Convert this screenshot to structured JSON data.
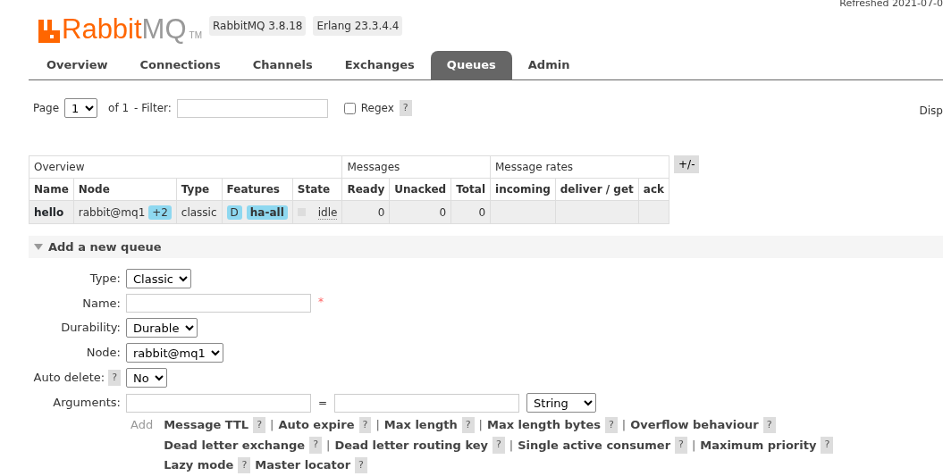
{
  "header": {
    "logo_main": "Rabbit",
    "logo_suffix": "MQ",
    "logo_tm": "TM",
    "versions": [
      "RabbitMQ 3.8.18",
      "Erlang 23.3.4.4"
    ],
    "refreshed": "Refreshed 2021-07-0"
  },
  "tabs": [
    {
      "label": "Overview",
      "selected": false
    },
    {
      "label": "Connections",
      "selected": false
    },
    {
      "label": "Channels",
      "selected": false
    },
    {
      "label": "Exchanges",
      "selected": false
    },
    {
      "label": "Queues",
      "selected": true
    },
    {
      "label": "Admin",
      "selected": false
    }
  ],
  "pager": {
    "page_label": "Page",
    "page": "1",
    "of": "of 1",
    "filter_label": "- Filter:",
    "regex_label": "Regex",
    "regex_checked": false,
    "help": "?",
    "right_text": "Disp"
  },
  "table": {
    "groups": [
      {
        "label": "Overview",
        "columns": [
          "Name",
          "Node",
          "Type",
          "Features",
          "State"
        ]
      },
      {
        "label": "Messages",
        "columns": [
          "Ready",
          "Unacked",
          "Total"
        ]
      },
      {
        "label": "Message rates",
        "columns": [
          "incoming",
          "deliver / get",
          "ack"
        ]
      }
    ],
    "toggle": "+/-",
    "rows": [
      {
        "name": "hello",
        "node": "rabbit@mq1",
        "node_extra": "+2",
        "type": "classic",
        "features": [
          "D",
          "ha-all"
        ],
        "state": "idle",
        "ready": "0",
        "unacked": "0",
        "total": "0"
      }
    ]
  },
  "add_queue": {
    "title": "Add a new queue",
    "expanded": true,
    "fields": [
      {
        "label": "Type:",
        "kind": "select",
        "value": "Classic"
      },
      {
        "label": "Name:",
        "kind": "text",
        "required_mark": "*"
      },
      {
        "label": "Durability:",
        "kind": "select",
        "value": "Durable"
      },
      {
        "label": "Node:",
        "kind": "select",
        "value": "rabbit@mq1"
      },
      {
        "label": "Auto delete:",
        "kind": "select",
        "value": "No",
        "help": "?"
      },
      {
        "label": "Arguments:",
        "kind": "args",
        "equals": "=",
        "value": "String"
      }
    ],
    "add_label": "Add",
    "argument_rows": [
      [
        {
          "label": "Message TTL",
          "help": "?",
          "sep": "|"
        },
        {
          "label": "Auto expire",
          "help": "?",
          "sep": "|"
        },
        {
          "label": "Max length",
          "help": "?",
          "sep": "|"
        },
        {
          "label": "Max length bytes",
          "help": "?",
          "sep": "|"
        },
        {
          "label": "Overflow behaviour",
          "help": "?"
        }
      ],
      [
        {
          "label": "Dead letter exchange",
          "help": "?",
          "sep": "|"
        },
        {
          "label": "Dead letter routing key",
          "help": "?",
          "sep": "|"
        },
        {
          "label": "Single active consumer",
          "help": "?",
          "sep": "|"
        },
        {
          "label": "Maximum priority",
          "help": "?"
        }
      ],
      [
        {
          "label": "Lazy mode",
          "help": "?"
        },
        {
          "label": "Master locator",
          "help": "?"
        }
      ]
    ]
  }
}
